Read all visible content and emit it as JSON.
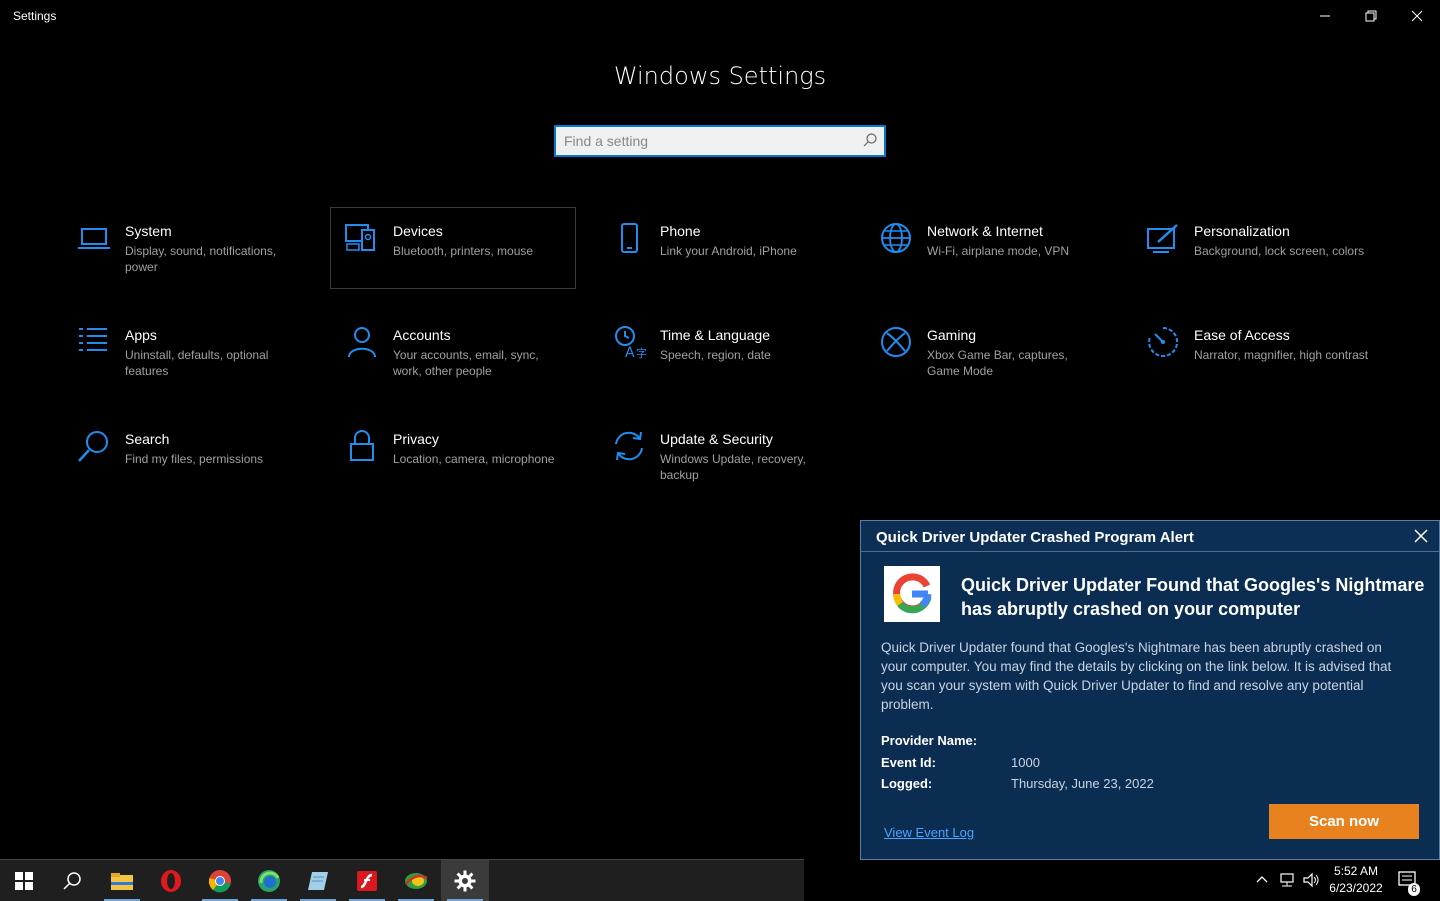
{
  "window": {
    "title": "Settings"
  },
  "header": {
    "title": "Windows Settings"
  },
  "search": {
    "placeholder": "Find a setting"
  },
  "tiles": [
    {
      "name": "System",
      "desc": "Display, sound, notifications, power",
      "icon": "laptop-icon"
    },
    {
      "name": "Devices",
      "desc": "Bluetooth, printers, mouse",
      "icon": "devices-icon"
    },
    {
      "name": "Phone",
      "desc": "Link your Android, iPhone",
      "icon": "phone-icon"
    },
    {
      "name": "Network & Internet",
      "desc": "Wi-Fi, airplane mode, VPN",
      "icon": "globe-icon"
    },
    {
      "name": "Personalization",
      "desc": "Background, lock screen, colors",
      "icon": "paintbrush-icon"
    },
    {
      "name": "Apps",
      "desc": "Uninstall, defaults, optional features",
      "icon": "apps-list-icon"
    },
    {
      "name": "Accounts",
      "desc": "Your accounts, email, sync, work, other people",
      "icon": "person-icon"
    },
    {
      "name": "Time & Language",
      "desc": "Speech, region, date",
      "icon": "time-language-icon"
    },
    {
      "name": "Gaming",
      "desc": "Xbox Game Bar, captures, Game Mode",
      "icon": "xbox-icon"
    },
    {
      "name": "Ease of Access",
      "desc": "Narrator, magnifier, high contrast",
      "icon": "ease-of-access-icon"
    },
    {
      "name": "Search",
      "desc": "Find my files, permissions",
      "icon": "magnifier-icon"
    },
    {
      "name": "Privacy",
      "desc": "Location, camera, microphone",
      "icon": "lock-icon"
    },
    {
      "name": "Update & Security",
      "desc": "Windows Update, recovery, backup",
      "icon": "sync-icon"
    }
  ],
  "popup": {
    "title": "Quick Driver Updater Crashed Program Alert",
    "headline": "Quick Driver Updater Found that Googles's Nightmare has abruptly crashed on your computer",
    "body": "Quick Driver Updater found that Googles's Nightmare has been abruptly crashed on your computer. You may find the details by clicking on the link below. It is advised that you scan your system with Quick Driver Updater to find and resolve any potential problem.",
    "provider_label": "Provider Name:",
    "provider_value": "",
    "event_label": "Event Id:",
    "event_value": "1000",
    "logged_label": "Logged:",
    "logged_value": "Thursday, June 23, 2022",
    "link": "View Event Log",
    "button": "Scan now",
    "accent": "#e8821f"
  },
  "taskbar": {
    "apps": [
      "start-icon",
      "search-icon",
      "file-explorer-icon",
      "opera-icon",
      "chrome-icon",
      "edge-icon",
      "notepad-icon",
      "flash-icon",
      "network-app-icon",
      "settings-gear-icon"
    ]
  },
  "tray": {
    "time": "5:52 AM",
    "date": "6/23/2022",
    "notifications": "6"
  },
  "colors": {
    "accent": "#0078d7",
    "background": "#000000"
  }
}
